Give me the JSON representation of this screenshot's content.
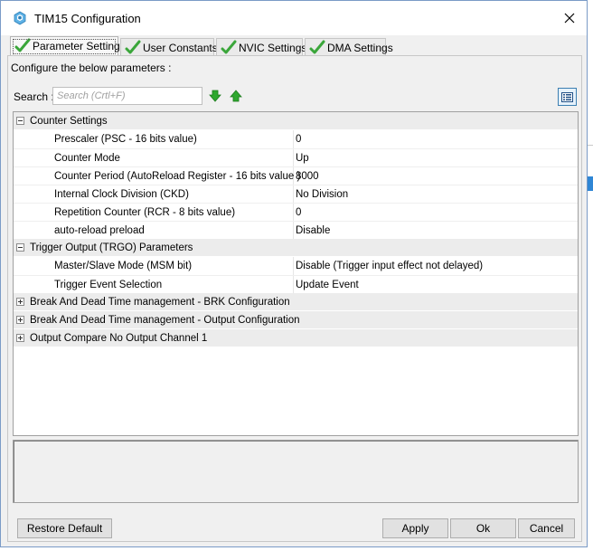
{
  "window": {
    "title": "TIM15 Configuration"
  },
  "tabs": [
    {
      "label": "Parameter Settings",
      "active": true
    },
    {
      "label": "User Constants",
      "active": false
    },
    {
      "label": "NVIC Settings",
      "active": false
    },
    {
      "label": "DMA Settings",
      "active": false
    }
  ],
  "panel": {
    "configure_label": "Configure the below parameters :",
    "search_label": "Search :",
    "search_placeholder": "Search (Crtl+F)",
    "search_value": ""
  },
  "groups": {
    "counter": {
      "label": "Counter Settings",
      "expanded": true,
      "params": [
        {
          "name": "Prescaler (PSC - 16 bits value)",
          "value": "0"
        },
        {
          "name": "Counter Mode",
          "value": "Up"
        },
        {
          "name": "Counter Period (AutoReload Register - 16 bits value )",
          "value": "8000"
        },
        {
          "name": "Internal Clock Division (CKD)",
          "value": "No Division"
        },
        {
          "name": "Repetition Counter (RCR - 8 bits value)",
          "value": "0"
        },
        {
          "name": "auto-reload preload",
          "value": "Disable"
        }
      ]
    },
    "trgo": {
      "label": "Trigger Output (TRGO) Parameters",
      "expanded": true,
      "params": [
        {
          "name": "Master/Slave Mode (MSM bit)",
          "value": "Disable (Trigger input effect not delayed)"
        },
        {
          "name": "Trigger Event Selection",
          "value": "Update Event"
        }
      ]
    },
    "brk": {
      "label": "Break And Dead Time management - BRK Configuration",
      "expanded": false
    },
    "output_cfg": {
      "label": "Break And Dead Time management - Output Configuration",
      "expanded": false
    },
    "oc": {
      "label": "Output Compare No Output Channel 1",
      "expanded": false
    }
  },
  "buttons": {
    "restore_default": "Restore Default",
    "apply": "Apply",
    "ok": "Ok",
    "cancel": "Cancel"
  },
  "colors": {
    "check_green": "#3aa63a",
    "arrow_green": "#2fa82f",
    "accent_blue": "#2f86d5"
  }
}
